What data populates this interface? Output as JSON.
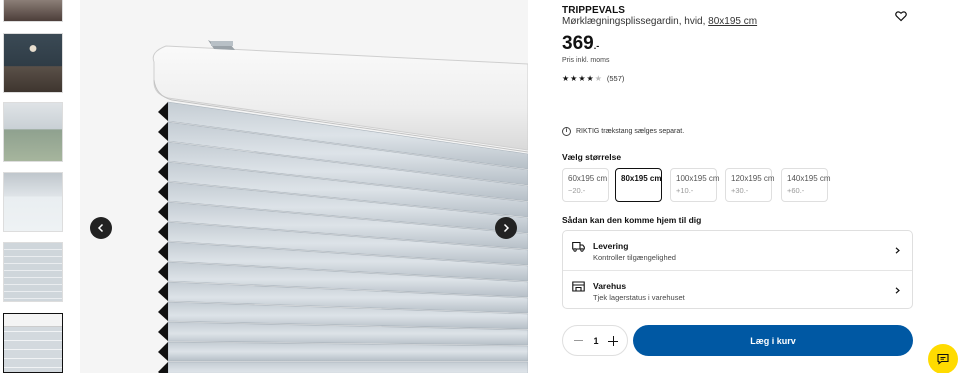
{
  "thumbnails": [
    {
      "name": "bedroom-photo"
    },
    {
      "name": "dark-room-photo"
    },
    {
      "name": "window-open-photo"
    },
    {
      "name": "pull-cord-photo"
    },
    {
      "name": "pleat-closeup-photo"
    },
    {
      "name": "headrail-closeup-photo",
      "selected": true
    }
  ],
  "product": {
    "name": "TRIPPEVALS",
    "description": "Mørklægningsplissegardin, hvid, ",
    "size_link": "80x195 cm",
    "price": "369",
    "price_suffix": ".-",
    "price_note": "Pris inkl. moms",
    "rating": {
      "stars": 4,
      "max": 5,
      "count": "(557)"
    }
  },
  "notice": {
    "text": "RIKTIG trækstang sælges separat."
  },
  "size_section": {
    "title": "Vælg størrelse",
    "options": [
      {
        "label": "60x195 cm",
        "delta": "−20.-",
        "selected": false
      },
      {
        "label": "80x195 cm",
        "delta": "",
        "selected": true
      },
      {
        "label": "100x195 cm",
        "delta": "+10.-",
        "selected": false
      },
      {
        "label": "120x195 cm",
        "delta": "+30.-",
        "selected": false
      },
      {
        "label": "140x195 cm",
        "delta": "+60.-",
        "selected": false
      }
    ]
  },
  "delivery_section": {
    "title": "Sådan kan den komme hjem til dig",
    "options": [
      {
        "title": "Levering",
        "subtitle": "Kontroller tilgængelighed",
        "icon": "truck-icon"
      },
      {
        "title": "Varehus",
        "subtitle": "Tjek lagerstatus i varehuset",
        "icon": "store-icon"
      }
    ]
  },
  "quantity": {
    "value": "1"
  },
  "cart_button": {
    "label": "Læg i kurv"
  },
  "colors": {
    "accent": "#0058a3",
    "chat": "#ffdb00"
  }
}
